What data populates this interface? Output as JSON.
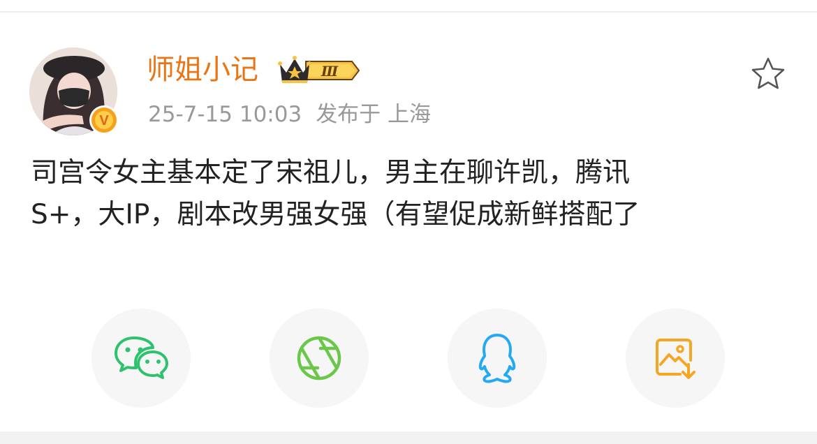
{
  "post": {
    "author": {
      "name": "师姐小记",
      "vip_level": "Ⅲ",
      "verified_mark": "V"
    },
    "meta": {
      "time": "25-7-15 10:03",
      "location": "发布于 上海"
    },
    "text_lines": [
      "司宫令女主基本定了宋祖儿，男主在聊许凯，腾讯",
      "S+，大IP，剧本改男强女强（有望促成新鲜搭配了"
    ],
    "favorite_icon": "star-outline-icon"
  },
  "share_actions": [
    {
      "icon": "wechat-icon",
      "color": "#2fc26e"
    },
    {
      "icon": "moments-icon",
      "color": "#6ac74a"
    },
    {
      "icon": "qq-icon",
      "color": "#27a8f2"
    },
    {
      "icon": "save-image-icon",
      "color": "#f5a623"
    }
  ],
  "colors": {
    "username": "#eb7414",
    "meta": "#999999",
    "text": "#222222",
    "vip_gold": "#f6c343",
    "verified": "#f7a11a"
  }
}
